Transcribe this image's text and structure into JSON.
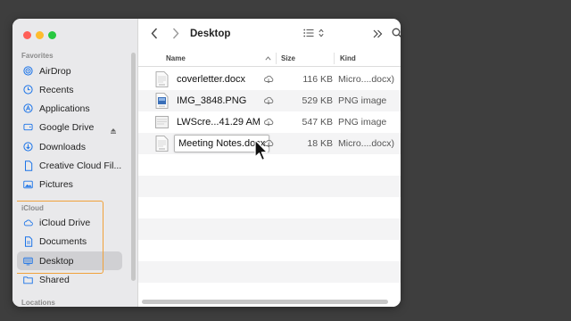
{
  "window": {
    "title": "Desktop"
  },
  "sidebar": {
    "favorites_header": "Favorites",
    "favorites": [
      {
        "label": "AirDrop",
        "icon": "airdrop-icon"
      },
      {
        "label": "Recents",
        "icon": "clock-icon"
      },
      {
        "label": "Applications",
        "icon": "applications-icon"
      },
      {
        "label": "Google Drive",
        "icon": "drive-icon"
      },
      {
        "label": "Downloads",
        "icon": "download-icon"
      },
      {
        "label": "Creative Cloud Fil...",
        "icon": "file-icon"
      },
      {
        "label": "Pictures",
        "icon": "photo-icon"
      }
    ],
    "icloud_header": "iCloud",
    "icloud": [
      {
        "label": "iCloud Drive",
        "icon": "cloud-icon"
      },
      {
        "label": "Documents",
        "icon": "document-icon"
      },
      {
        "label": "Desktop",
        "icon": "desktop-icon",
        "selected": true
      },
      {
        "label": "Shared",
        "icon": "shared-folder-icon"
      }
    ],
    "locations_header": "Locations"
  },
  "columns": {
    "name": "Name",
    "size": "Size",
    "kind": "Kind"
  },
  "files": [
    {
      "name": "coverletter.docx",
      "size": "116 KB",
      "kind": "Micro....docx)"
    },
    {
      "name": "IMG_3848.PNG",
      "size": "529 KB",
      "kind": "PNG image"
    },
    {
      "name": "LWScre...41.29 AM",
      "size": "547 KB",
      "kind": "PNG image"
    },
    {
      "name": "Meeting Notes.docx",
      "size": "18 KB",
      "kind": "Micro....docx)",
      "editing": true
    }
  ],
  "colors": {
    "selection_highlight": "#f0a13a",
    "accent": "#1a73e8"
  }
}
